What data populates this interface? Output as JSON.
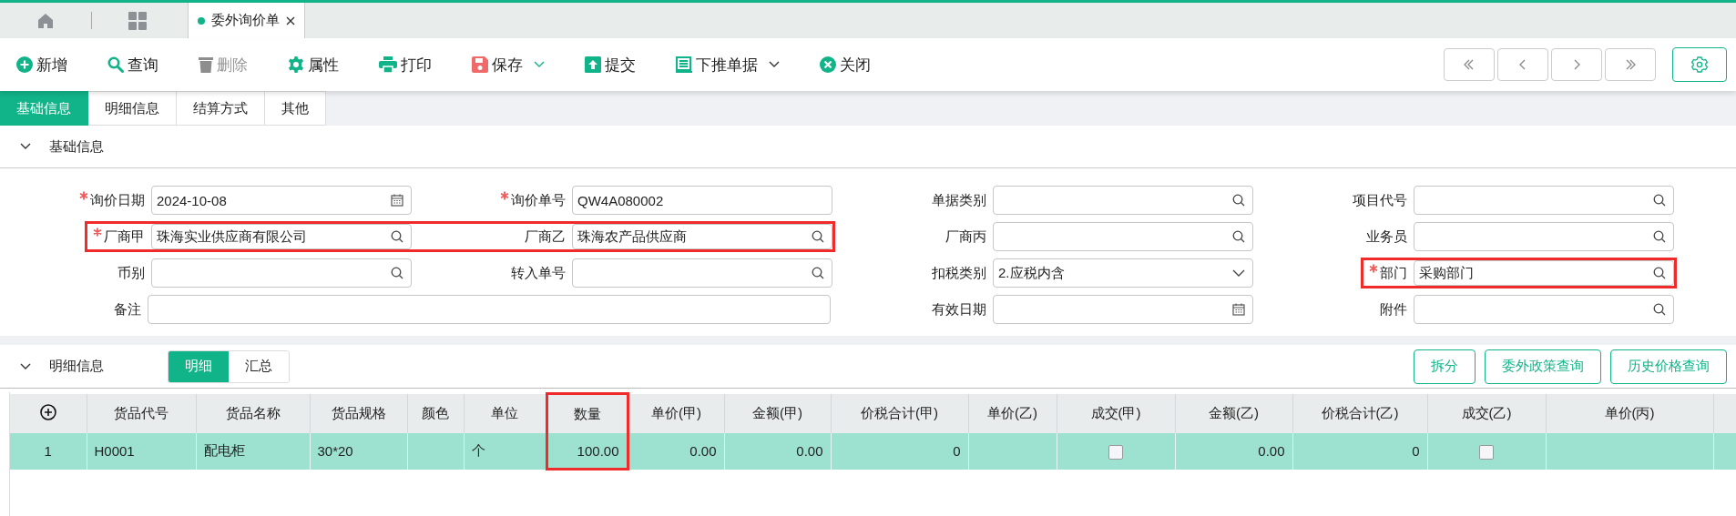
{
  "top_tabs": [
    {
      "kind": "home",
      "selected": false
    },
    {
      "kind": "apps",
      "selected": false
    },
    {
      "kind": "doc",
      "label": "委外询价单",
      "selected": true
    }
  ],
  "toolbar": [
    {
      "label": "新增",
      "disabled": false,
      "dropdown": false
    },
    {
      "label": "查询",
      "disabled": false,
      "dropdown": false
    },
    {
      "label": "删除",
      "disabled": true,
      "dropdown": false
    },
    {
      "label": "属性",
      "disabled": false,
      "dropdown": false
    },
    {
      "label": "打印",
      "disabled": false,
      "dropdown": false
    },
    {
      "label": "保存",
      "disabled": false,
      "dropdown": true
    },
    {
      "label": "提交",
      "disabled": false,
      "dropdown": false
    },
    {
      "label": "下推单据",
      "disabled": false,
      "dropdown": true
    },
    {
      "label": "关闭",
      "disabled": false,
      "dropdown": false
    }
  ],
  "nav_buttons": [
    {
      "kind": "first"
    },
    {
      "kind": "prev"
    },
    {
      "kind": "next"
    },
    {
      "kind": "last"
    }
  ],
  "page_tabs": [
    {
      "label": "基础信息",
      "selected": true
    },
    {
      "label": "明细信息",
      "selected": false
    },
    {
      "label": "结算方式",
      "selected": false
    },
    {
      "label": "其他",
      "selected": false
    }
  ],
  "basic_section": {
    "title": "基础信息",
    "expanded": true,
    "rows": [
      [
        {
          "label": "询价日期",
          "required": true,
          "kind": "date",
          "value": "2024-10-08",
          "highlighted": false
        },
        {
          "label": "询价单号",
          "required": true,
          "kind": "text",
          "value": "QW4A080002",
          "highlighted": false
        },
        {
          "label": "单据类别",
          "required": false,
          "kind": "lookup",
          "highlighted": false
        },
        {
          "label": "项目代号",
          "required": false,
          "kind": "lookup",
          "highlighted": false
        }
      ],
      [
        {
          "label": "厂商甲",
          "required": true,
          "kind": "lookup",
          "value": "珠海实业供应商有限公司",
          "highlighted": true
        },
        {
          "label": "厂商乙",
          "required": false,
          "kind": "lookup",
          "value": "珠海农产品供应商",
          "highlighted": true
        },
        {
          "label": "厂商丙",
          "required": false,
          "kind": "lookup",
          "highlighted": false
        },
        {
          "label": "业务员",
          "required": false,
          "kind": "lookup",
          "highlighted": false
        }
      ],
      [
        {
          "label": "币别",
          "required": false,
          "kind": "lookup",
          "highlighted": false
        },
        {
          "label": "转入单号",
          "required": false,
          "kind": "lookup",
          "highlighted": false
        },
        {
          "label": "扣税类别",
          "required": false,
          "kind": "select",
          "value": "2.应税内含",
          "highlighted": false
        },
        {
          "label": "部门",
          "required": true,
          "kind": "lookup",
          "value": "采购部门",
          "highlighted": true
        }
      ],
      [
        {
          "label": "备注",
          "required": false,
          "kind": "memo",
          "highlighted": false
        },
        null,
        {
          "label": "有效日期",
          "required": false,
          "kind": "date",
          "highlighted": false
        },
        {
          "label": "附件",
          "required": false,
          "kind": "lookup",
          "highlighted": false
        }
      ]
    ]
  },
  "detail_section": {
    "title": "明细信息",
    "expanded": true,
    "sub_tabs": [
      {
        "label": "明细",
        "selected": true
      },
      {
        "label": "汇总",
        "selected": false
      }
    ],
    "buttons": [
      "拆分",
      "委外政策查询",
      "历史价格查询"
    ],
    "table": {
      "columns": [
        {
          "kind": "add",
          "highlighted": false
        },
        {
          "label": "货品代号",
          "highlighted": false
        },
        {
          "label": "货品名称",
          "highlighted": false
        },
        {
          "label": "货品规格",
          "highlighted": false
        },
        {
          "label": "颜色",
          "highlighted": false
        },
        {
          "label": "单位",
          "highlighted": false
        },
        {
          "label": "数量",
          "highlighted": true
        },
        {
          "label": "单价(甲)",
          "highlighted": false
        },
        {
          "label": "金额(甲)",
          "highlighted": false
        },
        {
          "label": "价税合计(甲)",
          "highlighted": false
        },
        {
          "label": "单价(乙)",
          "highlighted": false
        },
        {
          "label": "成交(甲)",
          "highlighted": false
        },
        {
          "label": "金额(乙)",
          "highlighted": false
        },
        {
          "label": "价税合计(乙)",
          "highlighted": false
        },
        {
          "label": "成交(乙)",
          "highlighted": false
        },
        {
          "label": "单价(丙)",
          "highlighted": false
        }
      ],
      "rows": [
        {
          "selected": true,
          "cells": [
            {
              "kind": "index",
              "text": "1"
            },
            {
              "kind": "text",
              "text": "H0001"
            },
            {
              "kind": "text",
              "text": "配电柜"
            },
            {
              "kind": "text",
              "text": "30*20"
            },
            {
              "kind": "text"
            },
            {
              "kind": "text",
              "text": "个"
            },
            {
              "kind": "number",
              "text": "100.00"
            },
            {
              "kind": "number",
              "text": "0.00"
            },
            {
              "kind": "number",
              "text": "0.00"
            },
            {
              "kind": "number",
              "text": "0"
            },
            {
              "kind": "number"
            },
            {
              "kind": "checkbox",
              "checked": false
            },
            {
              "kind": "number",
              "text": "0.00"
            },
            {
              "kind": "number",
              "text": "0"
            },
            {
              "kind": "checkbox",
              "checked": false
            },
            {
              "kind": "number"
            }
          ]
        }
      ]
    }
  }
}
